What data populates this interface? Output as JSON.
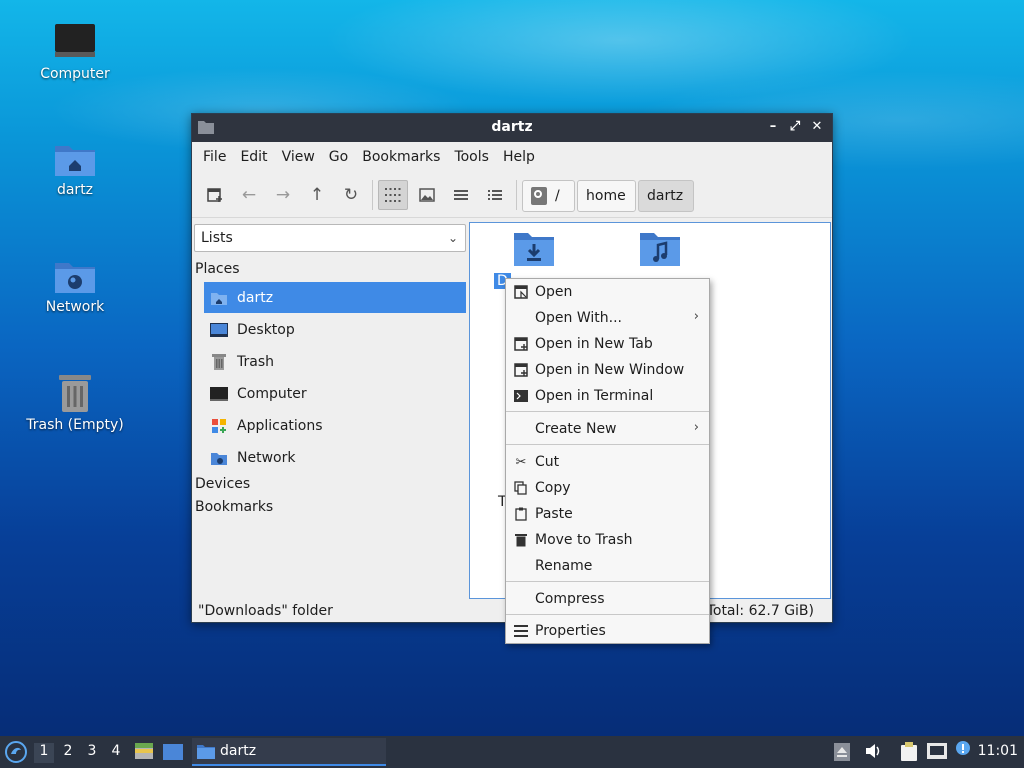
{
  "desktop": {
    "icons": [
      {
        "label": "Computer",
        "icon": "computer-icon"
      },
      {
        "label": "dartz",
        "icon": "home-folder-icon"
      },
      {
        "label": "Network",
        "icon": "network-folder-icon"
      },
      {
        "label": "Trash (Empty)",
        "icon": "trash-icon"
      }
    ]
  },
  "window": {
    "title": "dartz",
    "controls": {
      "minimize": "–",
      "maximize": "⤢",
      "close": "✕"
    }
  },
  "menubar": {
    "items": [
      "File",
      "Edit",
      "View",
      "Go",
      "Bookmarks",
      "Tools",
      "Help"
    ]
  },
  "toolbar": {
    "path_root": "/",
    "crumbs": [
      "home",
      "dartz"
    ]
  },
  "sidebar": {
    "combo_value": "Lists",
    "places_header": "Places",
    "places": [
      {
        "label": "dartz",
        "icon": "home-icon"
      },
      {
        "label": "Desktop",
        "icon": "desktop-icon"
      },
      {
        "label": "Trash",
        "icon": "trash-icon"
      },
      {
        "label": "Computer",
        "icon": "computer-icon"
      },
      {
        "label": "Applications",
        "icon": "applications-icon"
      },
      {
        "label": "Network",
        "icon": "network-icon"
      }
    ],
    "devices_header": "Devices",
    "bookmarks_header": "Bookmarks"
  },
  "files": {
    "downloads_label_visible": "D",
    "partial_label": "T"
  },
  "statusbar": {
    "left": "\"Downloads\" folder",
    "right": "Total: 62.7 GiB)"
  },
  "context_menu": {
    "open": "Open",
    "open_with": "Open With...",
    "open_new_tab": "Open in New Tab",
    "open_new_window": "Open in New Window",
    "open_terminal": "Open in Terminal",
    "create_new": "Create New",
    "cut": "Cut",
    "copy": "Copy",
    "paste": "Paste",
    "move_trash": "Move to Trash",
    "rename": "Rename",
    "compress": "Compress",
    "properties": "Properties"
  },
  "taskbar": {
    "workspaces": [
      "1",
      "2",
      "3",
      "4"
    ],
    "task_label": "dartz",
    "clock": "11:01"
  },
  "colors": {
    "accent": "#3f8ae6",
    "titlebar": "#2f343f",
    "taskbar": "#2a3240",
    "folder": "#4a86d8"
  }
}
